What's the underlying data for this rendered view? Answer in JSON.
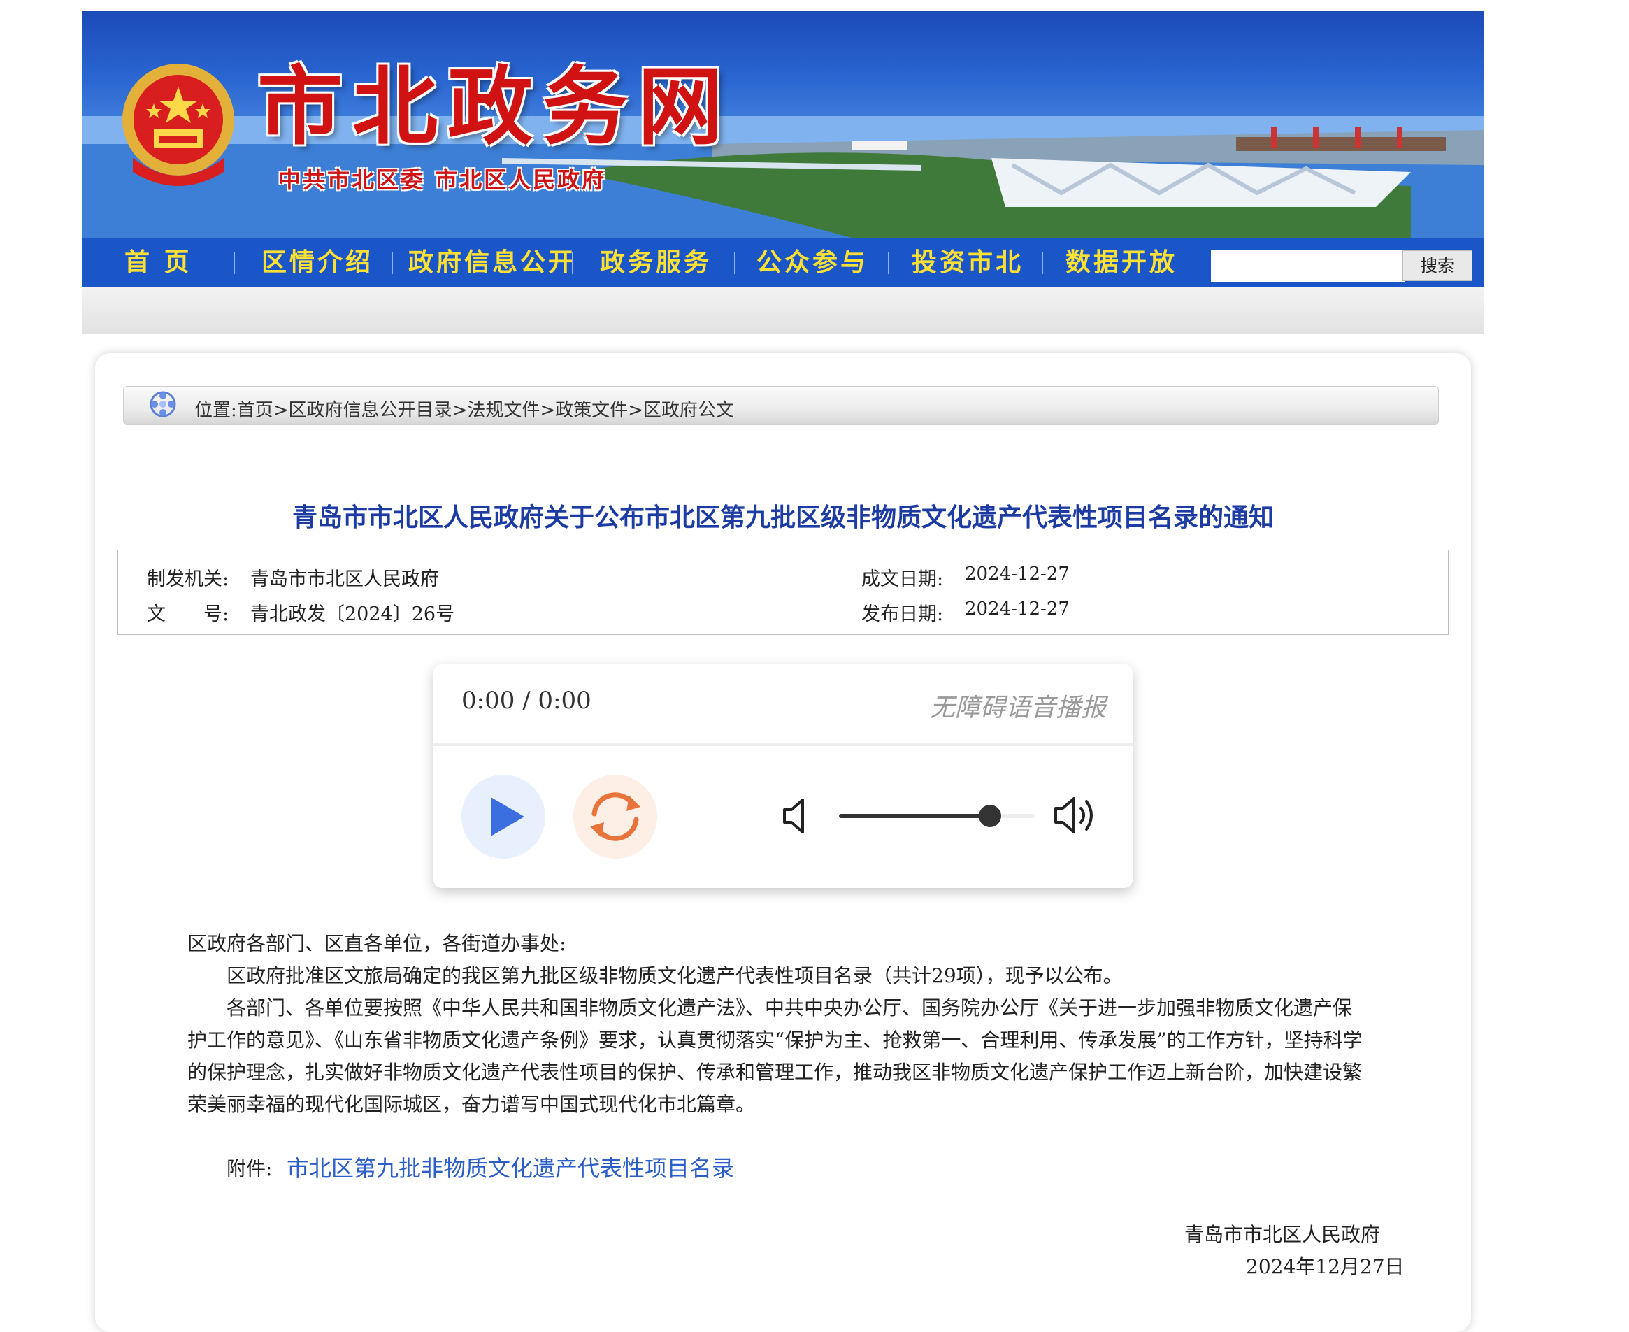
{
  "header": {
    "site_title": "市北政务网",
    "subtitle": "中共市北区委   市北区人民政府"
  },
  "nav": {
    "items": [
      "首  页",
      "区情介绍",
      "政府信息公开",
      "政务服务",
      "公众参与",
      "投资市北",
      "数据开放"
    ],
    "search_placeholder": "",
    "search_label": "搜索"
  },
  "breadcrumb": "位置:首页>区政府信息公开目录>法规文件>政策文件>区政府公文",
  "document": {
    "title": "青岛市市北区人民政府关于公布市北区第九批区级非物质文化遗产代表性项目名录的通知",
    "meta": {
      "issuer_label": "制发机关:",
      "issuer": "青岛市市北区人民政府",
      "number_label": "文　　号:",
      "number": "青北政发〔2024〕26号",
      "written_label": "成文日期:",
      "written_date": "2024-12-27",
      "published_label": "发布日期:",
      "published_date": "2024-12-27"
    }
  },
  "player": {
    "time": "0:00 / 0:00",
    "caption": "无障碍语音播报",
    "volume": 0.77,
    "colors": {
      "play": "#3b6fe0",
      "replay": "#e8743b"
    }
  },
  "body": {
    "salutation": "区政府各部门、区直各单位，各街道办事处:",
    "lines": [
      "　　区政府批准区文旅局确定的我区第九批区级非物质文化遗产代表性项目名录（共计29项），现予以公布。",
      "　　各部门、各单位要按照《中华人民共和国非物质文化遗产法》、中共中央办公厅、国务院办公厅《关于进一步加强非物质文化遗产保",
      "护工作的意见》、《山东省非物质文化遗产条例》要求，认真贯彻落实“保护为主、抢救第一、合理利用、传承发展”的工作方针，坚持科学",
      "的保护理念，扎实做好非物质文化遗产代表性项目的保护、传承和管理工作，推动我区非物质文化遗产保护工作迈上新台阶，加快建设繁",
      "荣美丽幸福的现代化国际城区，奋力谱写中国式现代化市北篇章。"
    ],
    "attachment_label": "附件:",
    "attachment_link": "市北区第九批非物质文化遗产代表性项目名录",
    "signature_org": "青岛市市北区人民政府",
    "signature_date": "2024年12月27日"
  }
}
